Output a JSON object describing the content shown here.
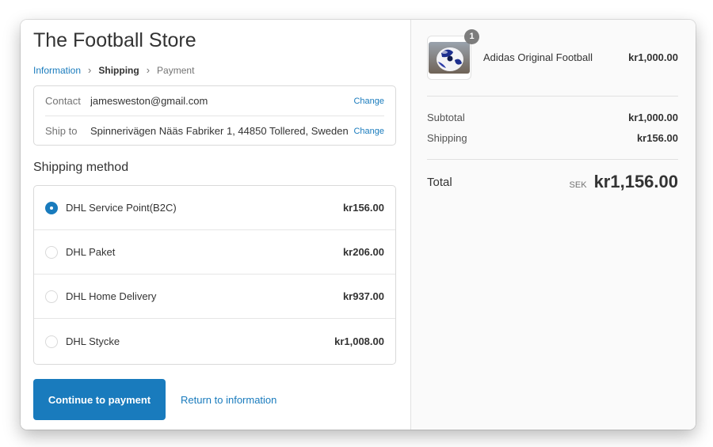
{
  "store": {
    "title": "The Football Store"
  },
  "breadcrumb": {
    "information": "Information",
    "shipping": "Shipping",
    "payment": "Payment"
  },
  "review": {
    "contact_label": "Contact",
    "contact_value": "jamesweston@gmail.com",
    "ship_to_label": "Ship to",
    "ship_to_value": "Spinnerivägen Nääs Fabriker 1, 44850 Tollered, Sweden",
    "change_label": "Change"
  },
  "shipping_method": {
    "title": "Shipping method",
    "selected_index": 0,
    "options": [
      {
        "label": "DHL Service Point(B2C)",
        "price": "kr156.00"
      },
      {
        "label": "DHL Paket",
        "price": "kr206.00"
      },
      {
        "label": "DHL Home Delivery",
        "price": "kr937.00"
      },
      {
        "label": "DHL Stycke",
        "price": "kr1,008.00"
      }
    ]
  },
  "actions": {
    "continue_label": "Continue to payment",
    "return_label": "Return to information"
  },
  "order_summary": {
    "product": {
      "name": "Adidas Original Football",
      "price": "kr1,000.00",
      "quantity": "1",
      "image_icon": "football-image"
    },
    "subtotal_label": "Subtotal",
    "subtotal_value": "kr1,000.00",
    "shipping_label": "Shipping",
    "shipping_value": "kr156.00",
    "total_label": "Total",
    "currency_code": "SEK",
    "total_value": "kr1,156.00"
  },
  "colors": {
    "accent": "#197bbd",
    "text": "#333333",
    "muted": "#737373",
    "sidebar_bg": "#fafafa",
    "border": "#d9d9d9"
  }
}
